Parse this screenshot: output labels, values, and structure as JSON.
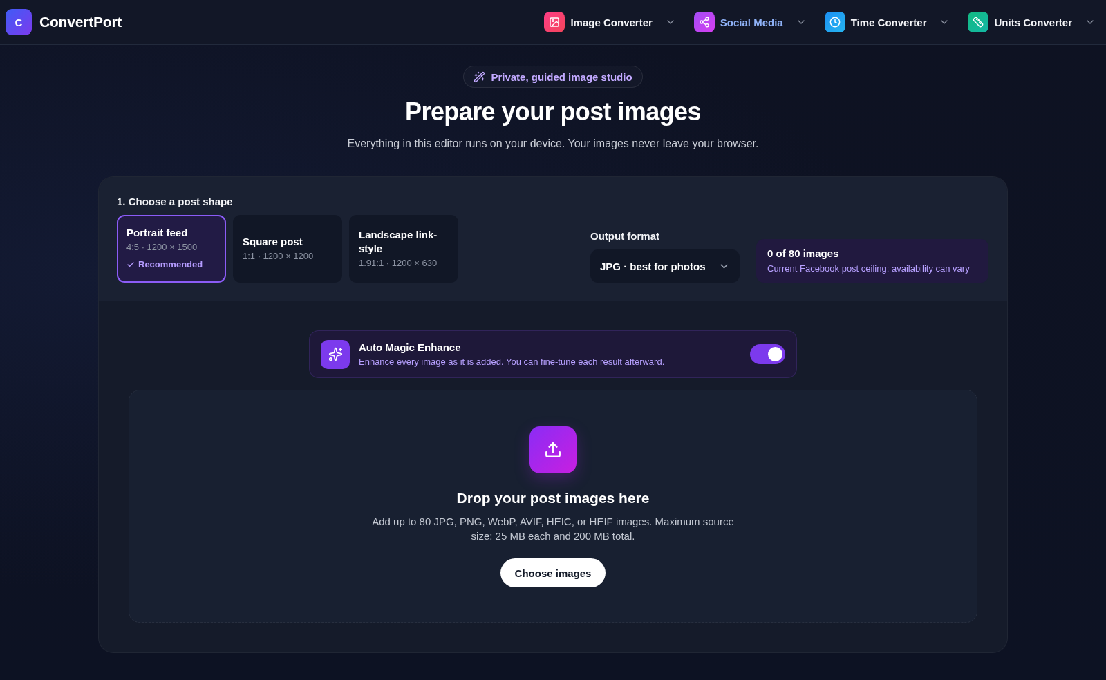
{
  "header": {
    "logo": {
      "letter": "C",
      "name": "ConvertPort"
    },
    "nav": [
      {
        "label": "Image Converter",
        "kind": "image",
        "selected": false
      },
      {
        "label": "Social Media",
        "kind": "share",
        "selected": true
      },
      {
        "label": "Time Converter",
        "kind": "clock",
        "selected": false
      },
      {
        "label": "Units Converter",
        "kind": "ruler",
        "selected": false
      }
    ]
  },
  "hero": {
    "tagline": "Private, guided image studio",
    "title": "Prepare your post images",
    "subtitle": "Everything in this editor runs on your device. Your images never leave your browser."
  },
  "shape_step": {
    "heading": "1. Choose a post shape",
    "shapes": [
      {
        "name": "Portrait feed",
        "spec": "4:5 · 1200 × 1500",
        "note": "Recommended",
        "selected": true
      },
      {
        "name": "Square post",
        "spec": "1:1 · 1200 × 1200",
        "selected": false
      },
      {
        "name": "Landscape link-style",
        "spec": "1.91:1 · 1200 × 630",
        "selected": false
      }
    ]
  },
  "output_format": {
    "label": "Output format",
    "value": "JPG · best for photos"
  },
  "image_count": {
    "count": "0 of 80 images",
    "note": "Current Facebook post ceiling; availability can vary"
  },
  "enhance": {
    "title": "Auto Magic Enhance",
    "description": "Enhance every image as it is added. You can fine-tune each result afterward.",
    "on": true
  },
  "drop_zone": {
    "title": "Drop your post images here",
    "description": "Add up to 80 JPG, PNG, WebP, AVIF, HEIC, or HEIF images. Maximum source size: 25 MB each and 200 MB total.",
    "button": "Choose images"
  }
}
